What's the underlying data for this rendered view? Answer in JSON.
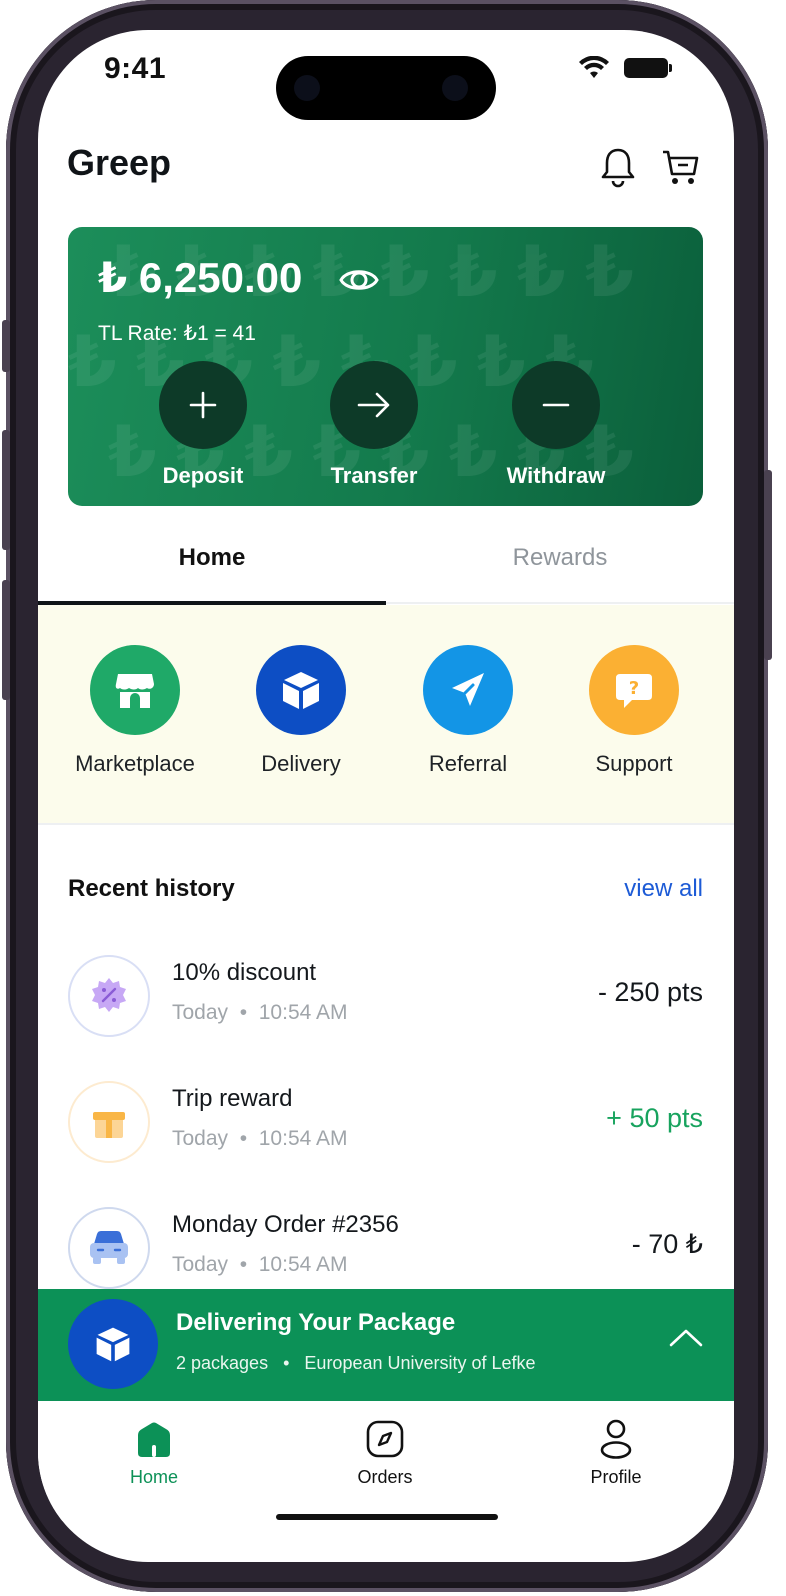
{
  "status_bar": {
    "time": "9:41"
  },
  "header": {
    "title": "Greep",
    "bell_icon": "bell-icon",
    "cart_icon": "cart-icon"
  },
  "balance_card": {
    "balance": "₺ 6,250.00",
    "rate": "TL Rate: ₺1 = 41",
    "pattern_glyph": "₺",
    "actions": [
      {
        "label": "Deposit",
        "icon": "plus-icon"
      },
      {
        "label": "Transfer",
        "icon": "arrow-right-icon"
      },
      {
        "label": "Withdraw",
        "icon": "minus-icon"
      }
    ],
    "gradient": [
      "#1c8e5a",
      "#0b5f3b"
    ]
  },
  "tabs": [
    {
      "label": "Home",
      "active": true
    },
    {
      "label": "Rewards",
      "active": false
    }
  ],
  "quick_actions": [
    {
      "label": "Marketplace",
      "icon": "store-icon",
      "color": "#1fa968"
    },
    {
      "label": "Delivery",
      "icon": "box-icon",
      "color": "#0d4ec4"
    },
    {
      "label": "Referral",
      "icon": "send-icon",
      "color": "#1395e6"
    },
    {
      "label": "Support",
      "icon": "help-chat-icon",
      "color": "#fbb033"
    }
  ],
  "recent_history": {
    "title": "Recent history",
    "view_all": "view all",
    "items": [
      {
        "title": "10% discount",
        "date": "Today",
        "time": "10:54 AM",
        "amount": "- 250 pts",
        "icon": "discount-badge-icon",
        "amount_color": "#14181c"
      },
      {
        "title": "Trip reward",
        "date": "Today",
        "time": "10:54 AM",
        "amount": "+ 50 pts",
        "icon": "gift-icon",
        "amount_color": "#18a35e"
      },
      {
        "title": "Monday Order #2356",
        "date": "Today",
        "time": "10:54 AM",
        "amount": "- 70 ₺",
        "icon": "car-icon",
        "amount_color": "#14181c"
      }
    ]
  },
  "delivery_banner": {
    "title": "Delivering Your Package",
    "packages": "2 packages",
    "location": "European University of Lefke",
    "separator": "•"
  },
  "bottom_nav": [
    {
      "label": "Home",
      "icon": "home-icon",
      "active": true
    },
    {
      "label": "Orders",
      "icon": "compass-icon",
      "active": false
    },
    {
      "label": "Profile",
      "icon": "profile-icon",
      "active": false
    }
  ],
  "colors": {
    "brand_green": "#0c9157",
    "link_blue": "#1d5bd6",
    "active_nav": "#0c9157"
  }
}
